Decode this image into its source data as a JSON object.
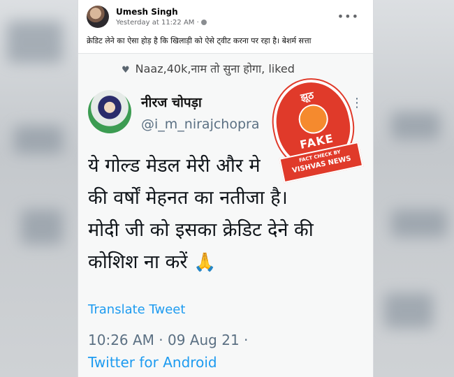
{
  "facebook_post": {
    "author": "Umesh Singh",
    "timestamp": "Yesterday at 11:22 AM ·",
    "more_icon": "ellipsis-icon",
    "caption": "क्रेडिट लेने का ऐसा होड़ है कि खिलाड़ी को ऐसे ट्वीट करना पर रहा है। बेशर्म सत्ता"
  },
  "tweet": {
    "liked_line": "Naaz,40k,नाम तो सुना होगा, liked",
    "name": "नीरज चोपड़ा",
    "handle": "@i_m_nirajchopra",
    "text_lines": [
      "ये गोल्ड मेडल मेरी और मे",
      "की वर्षों मेहनत का नतीजा है।",
      "मोदी जी को इसका क्रेडिट देने की",
      "कोशिश ना करें"
    ],
    "emoji": "🙏",
    "translate_label": "Translate Tweet",
    "date": "10:26 AM · 09 Aug 21 ·",
    "client": "Twitter for Android"
  },
  "stamp": {
    "top_text": "झूठ",
    "fake_label": "FAKE",
    "ribbon_line1": "FACT CHECK BY",
    "ribbon_line2": "VISHVAS NEWS",
    "color": "#e03a2a"
  }
}
